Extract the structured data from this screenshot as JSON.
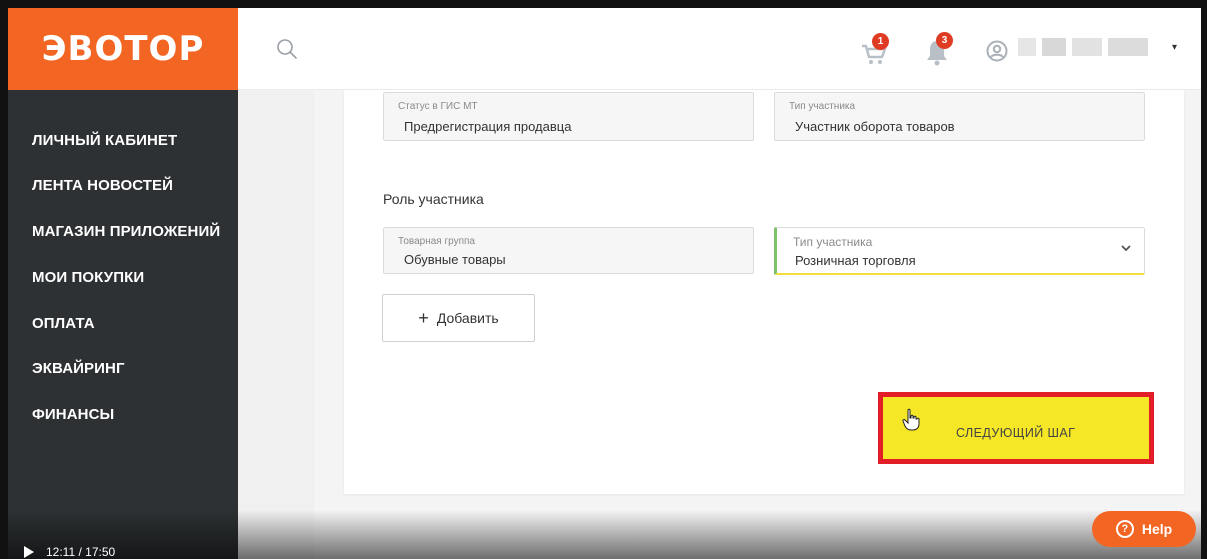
{
  "logo": {
    "text": "ЭВОТОР"
  },
  "colors": {
    "brand": "#f26522",
    "sidebar": "#2d3133",
    "highlight_border": "#e41e26",
    "highlight_fill": "#f5e626",
    "badge": "#e03c24"
  },
  "sidebar": {
    "items": [
      {
        "label": "ЛИЧНЫЙ КАБИНЕТ"
      },
      {
        "label": "ЛЕНТА НОВОСТЕЙ"
      },
      {
        "label": "МАГАЗИН ПРИЛОЖЕНИЙ"
      },
      {
        "label": "МОИ ПОКУПКИ"
      },
      {
        "label": "ОПЛАТА"
      },
      {
        "label": "ЭКВАЙРИНГ"
      },
      {
        "label": "ФИНАНСЫ"
      }
    ]
  },
  "header": {
    "search_icon": "search-icon",
    "cart_badge": "1",
    "notifications_badge": "3",
    "user_menu_caret": "▾"
  },
  "form": {
    "status": {
      "label": "Статус в ГИС МТ",
      "value": "Предрегистрация продавца"
    },
    "participant_type": {
      "label": "Тип участника",
      "value": "Участник оборота товаров"
    },
    "role_title": "Роль участника",
    "product_group": {
      "label": "Товарная группа",
      "value": "Обувные товары"
    },
    "role_type": {
      "label": "Тип участника",
      "value": "Розничная торговля"
    },
    "add_button": {
      "plus": "+",
      "label": "Добавить"
    },
    "next_button": {
      "label": "СЛЕДУЮЩИЙ ШАГ"
    }
  },
  "video": {
    "time": "12:11 / 17:50"
  },
  "help": {
    "label": "Help",
    "icon_glyph": "?"
  }
}
